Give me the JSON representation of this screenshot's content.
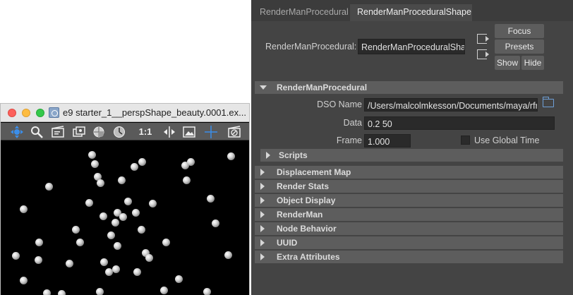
{
  "attribute_editor": {
    "tabs": [
      {
        "label": "RenderManProcedural"
      },
      {
        "label": "RenderManProceduralShape"
      }
    ],
    "node_label": "RenderManProcedural:",
    "node_value": "RenderManProceduralShape",
    "buttons": {
      "focus": "Focus",
      "presets": "Presets",
      "show": "Show",
      "hide": "Hide"
    },
    "main_section": "RenderManProcedural",
    "fields": {
      "dso_label": "DSO Name",
      "dso_value": "/Users/malcolmkesson/Documents/maya/rfr",
      "data_label": "Data",
      "data_value": "0.2 50",
      "frame_label": "Frame",
      "frame_value": "1.000",
      "global_time_label": "Use Global Time"
    },
    "scripts_section": "Scripts",
    "sections": [
      "Displacement Map",
      "Render Stats",
      "Object Display",
      "RenderMan",
      "Node Behavior",
      "UUID",
      "Extra Attributes"
    ]
  },
  "render_window": {
    "title": "e9 starter_1__perspShape_beauty.0001.ex...",
    "toolbar_ratio_label": "1:1",
    "icons": [
      "move-icon",
      "zoom-icon",
      "clapboard-icon",
      "snapshot-icon",
      "sphere-render-icon",
      "clock-icon",
      "ratio-1to1-icon",
      "split-compare-icon",
      "image-icon",
      "crosshair-icon",
      "clapboard-disabled-icon"
    ]
  }
}
